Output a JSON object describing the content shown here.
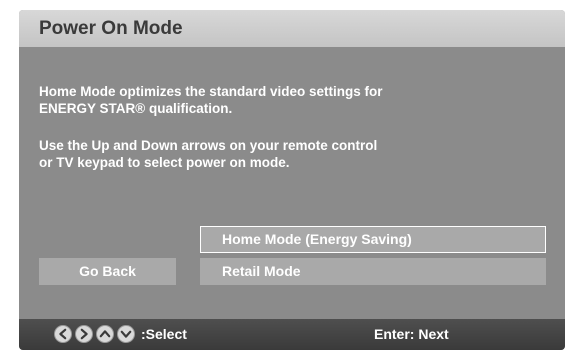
{
  "screen": {
    "title": "Power On Mode",
    "description": {
      "line1": "Home Mode optimizes the standard video settings for",
      "line2": "ENERGY STAR® qualification.",
      "line3": "Use the Up and Down arrows on your remote control",
      "line4": "or TV keypad to select power on mode."
    },
    "options": [
      {
        "label": "Home Mode (Energy Saving)",
        "selected": true
      },
      {
        "label": "Retail Mode",
        "selected": false
      }
    ],
    "go_back_label": "Go Back"
  },
  "footer": {
    "nav_icons": [
      "arrow-left-icon",
      "arrow-right-icon",
      "arrow-up-icon",
      "arrow-down-icon"
    ],
    "select_label": ":Select",
    "enter_label": "Enter: Next"
  },
  "colors": {
    "panel_background": "#8b8b8b",
    "title_bar": "#d0d0d0",
    "option_background": "#a9a9a9",
    "footer_background": "#444444",
    "text": "#ffffff"
  }
}
